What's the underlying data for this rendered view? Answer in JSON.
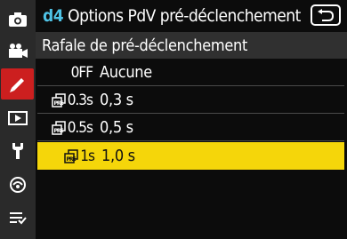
{
  "header": {
    "code": "d4",
    "title": "Options PdV pré-déclenchement",
    "accent_color": "#4fc3e6"
  },
  "sidebar": {
    "items": [
      {
        "icon": "camera-icon"
      },
      {
        "icon": "movie-camera-icon"
      },
      {
        "icon": "pencil-icon",
        "active": true
      },
      {
        "icon": "playback-icon"
      },
      {
        "icon": "wrench-icon"
      },
      {
        "icon": "network-icon"
      },
      {
        "icon": "my-menu-icon"
      }
    ],
    "active_color": "#cc1f1f"
  },
  "subheader": {
    "label": "Rafale de pré-déclenchement"
  },
  "options": [
    {
      "code": "0FF",
      "value": "Aucune",
      "icon": false
    },
    {
      "code": "0.3s",
      "value": "0,3 s",
      "icon": true
    },
    {
      "code": "0.5s",
      "value": "0,5 s",
      "icon": true
    },
    {
      "code": "1s",
      "value": "1,0 s",
      "icon": true,
      "selected": true
    }
  ],
  "selection_color": "#f5d60a"
}
